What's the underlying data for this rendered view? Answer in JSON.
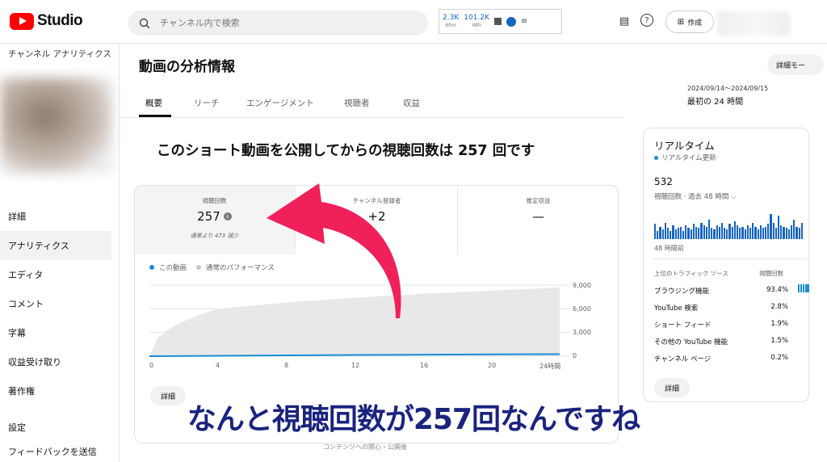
{
  "header": {
    "logo_text": "Studio",
    "search_placeholder": "チャンネル内で検索",
    "stats": [
      {
        "value": "2.3K",
        "label": "60m"
      },
      {
        "value": "101.2K",
        "label": "48h"
      }
    ],
    "create_label": "作成"
  },
  "sidebar": {
    "title": "チャンネル アナリティクス",
    "items": [
      {
        "label": "詳細"
      },
      {
        "label": "アナリティクス",
        "active": true
      },
      {
        "label": "エディタ"
      },
      {
        "label": "コメント"
      },
      {
        "label": "字幕"
      },
      {
        "label": "収益受け取り"
      },
      {
        "label": "著作権"
      },
      {
        "label": "設定"
      },
      {
        "label": "フィードバックを送信"
      }
    ]
  },
  "main": {
    "title": "動画の分析情報",
    "advanced_button": "詳細モー",
    "tabs": [
      "概要",
      "リーチ",
      "エンゲージメント",
      "視聴者",
      "収益"
    ],
    "active_tab": 0,
    "date_range": "2024/09/14～2024/09/15",
    "date_sub": "最初の 24 時間",
    "headline": "このショート動画を公開してからの視聴回数は 257 回です",
    "metrics": [
      {
        "label": "視聴回数",
        "value": "257",
        "sub": "通常より 473 減少"
      },
      {
        "label": "チャンネル登録者",
        "value": "+2",
        "sub": ""
      },
      {
        "label": "推定収益",
        "value": "—",
        "sub": ""
      }
    ],
    "legend": {
      "this_video": "この動画",
      "typical": "通常のパフォーマンス"
    },
    "detail_button": "詳細"
  },
  "chart_data": {
    "type": "area",
    "x": [
      0,
      4,
      8,
      12,
      16,
      20,
      24
    ],
    "xticks": [
      "0",
      "4",
      "8",
      "12",
      "16",
      "20",
      "24時間"
    ],
    "yticks": [
      "9,000",
      "6,000",
      "3,000",
      "0"
    ],
    "ylim": [
      0,
      9000
    ],
    "series": [
      {
        "name": "この動画",
        "values": [
          0,
          50,
          100,
          150,
          190,
          230,
          257
        ],
        "color": "#1a8cd8"
      },
      {
        "name": "通常のパフォーマンス",
        "upper": [
          0,
          6000,
          6800,
          7400,
          7900,
          8300,
          8700
        ],
        "lower": [
          0,
          0,
          0,
          0,
          0,
          0,
          0
        ],
        "color": "#e8e8e8"
      }
    ]
  },
  "realtime": {
    "title": "リアルタイム",
    "live_label": "リアルタイム更新",
    "count": "532",
    "sub": "視聴回数 · 過去 48 時間",
    "ago": "48 時間前",
    "bars": [
      0.55,
      0.3,
      0.45,
      0.35,
      0.6,
      0.4,
      0.3,
      0.5,
      0.35,
      0.4,
      0.45,
      0.3,
      0.5,
      0.4,
      0.35,
      0.55,
      0.45,
      0.4,
      0.6,
      0.5,
      0.45,
      0.7,
      0.4,
      0.35,
      0.5,
      0.45,
      0.6,
      0.4,
      0.35,
      0.55,
      0.45,
      0.65,
      0.5,
      0.4,
      0.45,
      0.35,
      0.5,
      0.4,
      0.6,
      0.45,
      0.35,
      0.5,
      0.4,
      0.45,
      0.55,
      0.9,
      0.6,
      0.4,
      0.85,
      0.5,
      0.45,
      0.4,
      0.35,
      0.5,
      0.7,
      0.45,
      0.4,
      0.6
    ],
    "traffic_header": {
      "source": "上位のトラフィック ソース",
      "views": "視聴回数"
    },
    "traffic": [
      {
        "name": "ブラウジング機能",
        "value": "93.4%"
      },
      {
        "name": "YouTube 検索",
        "value": "2.8%"
      },
      {
        "name": "ショート フィード",
        "value": "1.9%"
      },
      {
        "name": "その他の YouTube 機能",
        "value": "1.5%"
      },
      {
        "name": "チャンネル ページ",
        "value": "0.2%"
      }
    ],
    "detail_button": "詳細"
  },
  "overlay": {
    "caption": "なんと視聴回数が257回なんですね",
    "footnote": "コンテンツへの関心・公開後"
  },
  "colors": {
    "accent": "#1a8cd8",
    "arrow": "#f0205a",
    "caption": "#1a237e",
    "brand": "#ff0000"
  }
}
